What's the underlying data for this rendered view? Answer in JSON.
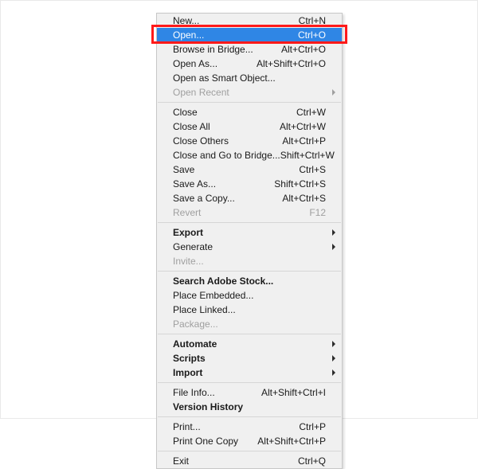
{
  "menu": {
    "groups": [
      [
        {
          "label": "New...",
          "shortcut": "Ctrl+N",
          "selected": false,
          "disabled": false,
          "submenu": false,
          "bold": false
        },
        {
          "label": "Open...",
          "shortcut": "Ctrl+O",
          "selected": true,
          "disabled": false,
          "submenu": false,
          "bold": false
        },
        {
          "label": "Browse in Bridge...",
          "shortcut": "Alt+Ctrl+O",
          "selected": false,
          "disabled": false,
          "submenu": false,
          "bold": false
        },
        {
          "label": "Open As...",
          "shortcut": "Alt+Shift+Ctrl+O",
          "selected": false,
          "disabled": false,
          "submenu": false,
          "bold": false
        },
        {
          "label": "Open as Smart Object...",
          "shortcut": "",
          "selected": false,
          "disabled": false,
          "submenu": false,
          "bold": false
        },
        {
          "label": "Open Recent",
          "shortcut": "",
          "selected": false,
          "disabled": true,
          "submenu": true,
          "bold": false
        }
      ],
      [
        {
          "label": "Close",
          "shortcut": "Ctrl+W",
          "selected": false,
          "disabled": false,
          "submenu": false,
          "bold": false
        },
        {
          "label": "Close All",
          "shortcut": "Alt+Ctrl+W",
          "selected": false,
          "disabled": false,
          "submenu": false,
          "bold": false
        },
        {
          "label": "Close Others",
          "shortcut": "Alt+Ctrl+P",
          "selected": false,
          "disabled": false,
          "submenu": false,
          "bold": false
        },
        {
          "label": "Close and Go to Bridge...",
          "shortcut": "Shift+Ctrl+W",
          "selected": false,
          "disabled": false,
          "submenu": false,
          "bold": false
        },
        {
          "label": "Save",
          "shortcut": "Ctrl+S",
          "selected": false,
          "disabled": false,
          "submenu": false,
          "bold": false
        },
        {
          "label": "Save As...",
          "shortcut": "Shift+Ctrl+S",
          "selected": false,
          "disabled": false,
          "submenu": false,
          "bold": false
        },
        {
          "label": "Save a Copy...",
          "shortcut": "Alt+Ctrl+S",
          "selected": false,
          "disabled": false,
          "submenu": false,
          "bold": false
        },
        {
          "label": "Revert",
          "shortcut": "F12",
          "selected": false,
          "disabled": true,
          "submenu": false,
          "bold": false
        }
      ],
      [
        {
          "label": "Export",
          "shortcut": "",
          "selected": false,
          "disabled": false,
          "submenu": true,
          "bold": true
        },
        {
          "label": "Generate",
          "shortcut": "",
          "selected": false,
          "disabled": false,
          "submenu": true,
          "bold": false
        },
        {
          "label": "Invite...",
          "shortcut": "",
          "selected": false,
          "disabled": true,
          "submenu": false,
          "bold": false
        }
      ],
      [
        {
          "label": "Search Adobe Stock...",
          "shortcut": "",
          "selected": false,
          "disabled": false,
          "submenu": false,
          "bold": true
        },
        {
          "label": "Place Embedded...",
          "shortcut": "",
          "selected": false,
          "disabled": false,
          "submenu": false,
          "bold": false
        },
        {
          "label": "Place Linked...",
          "shortcut": "",
          "selected": false,
          "disabled": false,
          "submenu": false,
          "bold": false
        },
        {
          "label": "Package...",
          "shortcut": "",
          "selected": false,
          "disabled": true,
          "submenu": false,
          "bold": false
        }
      ],
      [
        {
          "label": "Automate",
          "shortcut": "",
          "selected": false,
          "disabled": false,
          "submenu": true,
          "bold": true
        },
        {
          "label": "Scripts",
          "shortcut": "",
          "selected": false,
          "disabled": false,
          "submenu": true,
          "bold": true
        },
        {
          "label": "Import",
          "shortcut": "",
          "selected": false,
          "disabled": false,
          "submenu": true,
          "bold": true
        }
      ],
      [
        {
          "label": "File Info...",
          "shortcut": "Alt+Shift+Ctrl+I",
          "selected": false,
          "disabled": false,
          "submenu": false,
          "bold": false
        },
        {
          "label": "Version History",
          "shortcut": "",
          "selected": false,
          "disabled": false,
          "submenu": false,
          "bold": true
        }
      ],
      [
        {
          "label": "Print...",
          "shortcut": "Ctrl+P",
          "selected": false,
          "disabled": false,
          "submenu": false,
          "bold": false
        },
        {
          "label": "Print One Copy",
          "shortcut": "Alt+Shift+Ctrl+P",
          "selected": false,
          "disabled": false,
          "submenu": false,
          "bold": false
        }
      ],
      [
        {
          "label": "Exit",
          "shortcut": "Ctrl+Q",
          "selected": false,
          "disabled": false,
          "submenu": false,
          "bold": false
        }
      ]
    ]
  },
  "highlight_color": "#ff1a1a"
}
